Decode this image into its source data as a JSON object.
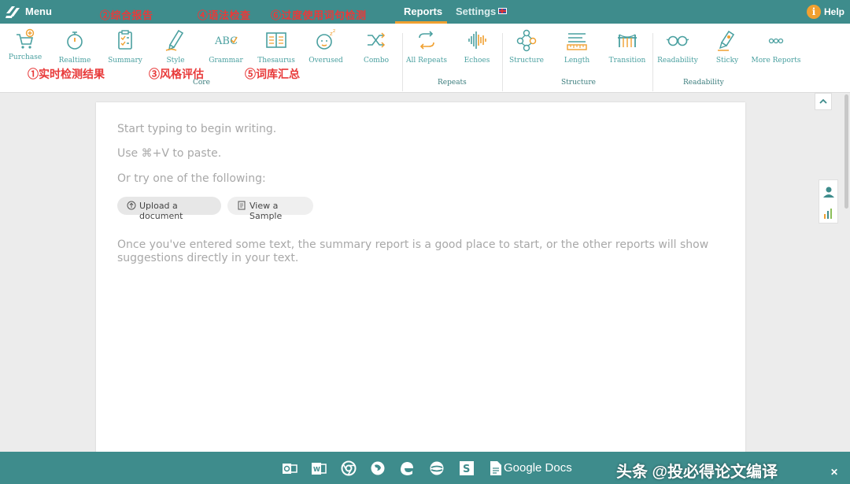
{
  "topbar": {
    "menu_label": "Menu",
    "tabs": [
      {
        "label": "Reports",
        "active": true
      },
      {
        "label": "Settings",
        "active": false
      }
    ],
    "help_label": "Help",
    "help_icon_text": "i",
    "annotations": [
      "②综合报告",
      "④语法检查",
      "⑥过度使用词句检测"
    ]
  },
  "toolbar": {
    "tools": [
      {
        "label": "Purchase",
        "icon": "cart-plus-icon"
      },
      {
        "label": "Realtime",
        "icon": "stopwatch-icon"
      },
      {
        "label": "Summary",
        "icon": "clipboard-icon"
      },
      {
        "label": "Style",
        "icon": "pen-icon"
      },
      {
        "label": "Grammar",
        "icon": "abc-check-icon"
      },
      {
        "label": "Thesaurus",
        "icon": "book-icon"
      },
      {
        "label": "Overused",
        "icon": "sleepy-face-icon"
      },
      {
        "label": "Combo",
        "icon": "shuffle-icon"
      },
      {
        "label": "All Repeats",
        "icon": "repeat-arrows-icon"
      },
      {
        "label": "Echoes",
        "icon": "soundwave-icon"
      },
      {
        "label": "Structure",
        "icon": "network-icon"
      },
      {
        "label": "Length",
        "icon": "ruler-icon"
      },
      {
        "label": "Transition",
        "icon": "bridge-icon"
      },
      {
        "label": "Readability",
        "icon": "glasses-icon"
      },
      {
        "label": "Sticky",
        "icon": "glue-icon"
      },
      {
        "label": "More Reports",
        "icon": "more-dots-icon"
      }
    ],
    "groups": [
      "Core",
      "Repeats",
      "Structure",
      "Readability"
    ],
    "annotations": [
      "①实时检测结果",
      "③风格评估",
      "⑤词库汇总"
    ]
  },
  "document": {
    "lines": [
      "Start typing to begin writing.",
      "Use ⌘+V to paste.",
      "Or try one of the following:"
    ],
    "upload_label": "Upload a document",
    "sample_label": "View a Sample",
    "hint": "Once you've entered some text, the summary report is a good place to start, or the other reports will show suggestions directly in your text."
  },
  "bottombar": {
    "apps": [
      "outlook-icon",
      "word-icon",
      "chrome-icon",
      "firefox-icon",
      "edge-icon",
      "safari-icon",
      "scrivener-icon",
      "google-docs-icon"
    ],
    "google_docs_label": "Google Docs",
    "watermark": "头条 @投必得论文编译",
    "close_icon": "close-icon"
  },
  "colors": {
    "teal": "#3e8c8c",
    "accent": "#f0a030",
    "annotation_red": "#e83a3a"
  }
}
